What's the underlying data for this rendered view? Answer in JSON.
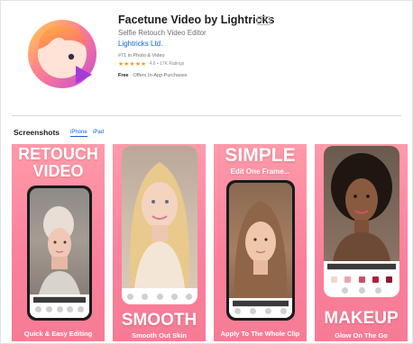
{
  "app": {
    "title": "Facetune Video by Lightricks",
    "age_rating": "4+",
    "subtitle": "Selfie Retouch Video Editor",
    "developer": "Lightricks Ltd.",
    "ranking": "#71 in Photo & Video",
    "stars": "★★★★★",
    "rating": "4.6 • 17K Ratings",
    "price": "Free",
    "price_note": "· Offers In-App Purchases",
    "icon": "facetune-video-app-icon"
  },
  "screenshots": {
    "heading": "Screenshots",
    "tabs": [
      "iPhone",
      "iPad"
    ],
    "cards": [
      {
        "headline": "RETOUCH VIDEO",
        "caption": "Quick & Easy Editing"
      },
      {
        "headline": "SMOOTH",
        "caption": "Smooth Out Skin"
      },
      {
        "headline": "SIMPLE",
        "subheadline": "Edit One Frame...",
        "caption": "Apply To The Whole Clip"
      },
      {
        "headline": "MAKEUP",
        "caption": "Glow On The Go"
      }
    ]
  },
  "colors": {
    "accent": "#0a64d6",
    "card_pink": "#fb7f9b",
    "star": "#ff9500"
  }
}
